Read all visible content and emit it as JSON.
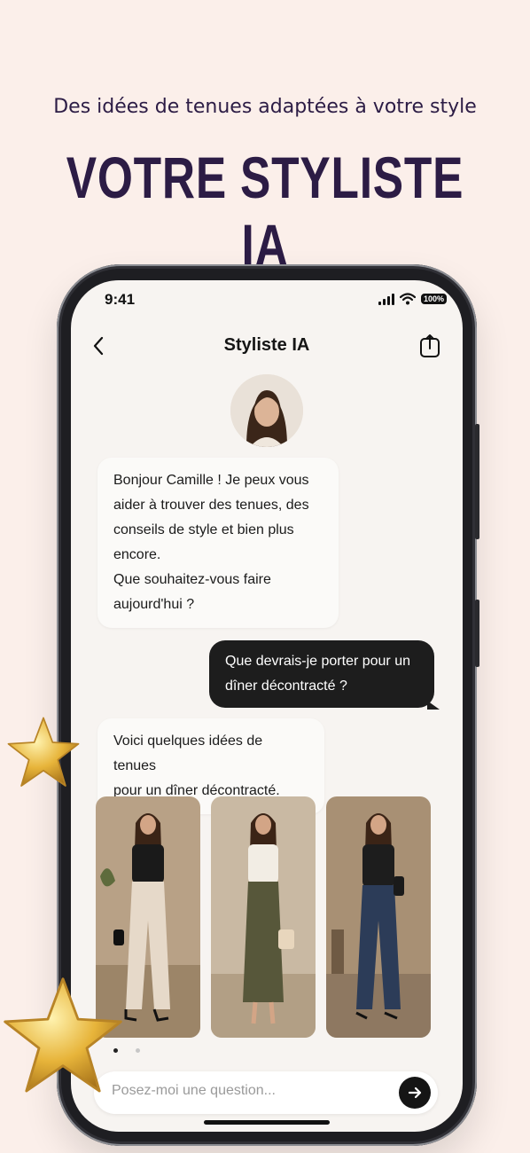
{
  "tagline": "Des idées de tenues adaptées à votre style",
  "headline": "VOTRE STYLISTE IA",
  "status": {
    "time": "9:41",
    "battery": "100%"
  },
  "chat": {
    "title": "Styliste IA",
    "messages": [
      {
        "role": "ai",
        "lines": [
          "Bonjour Camille ! Je peux vous",
          "aider à trouver des tenues, des",
          "conseils de style et bien plus",
          "encore.",
          "Que souhaitez-vous faire",
          "aujourd'hui ?"
        ]
      },
      {
        "role": "user",
        "lines": [
          "Que devrais-je porter pour un",
          "dîner décontracté ?"
        ]
      },
      {
        "role": "ai",
        "lines": [
          "Voici quelques idées de tenues",
          "pour un dîner décontracté."
        ]
      }
    ],
    "outfits": [
      {
        "name": "outfit-1",
        "top": "#1a1a1a",
        "bottom": "#e6d9c9",
        "bg": "#b8a186"
      },
      {
        "name": "outfit-2",
        "top": "#f2ede4",
        "bottom": "#57573a",
        "bg": "#c9b9a3"
      },
      {
        "name": "outfit-3",
        "top": "#1d1d1d",
        "bottom": "#2c3c58",
        "bg": "#a89074"
      }
    ],
    "carousel": {
      "pages": 2,
      "active": 1
    },
    "input": {
      "placeholder": "Posez-moi une question..."
    }
  },
  "colors": {
    "background": "#fbefea",
    "headline": "#2c1c45",
    "user_bubble": "#1d1d1d"
  }
}
